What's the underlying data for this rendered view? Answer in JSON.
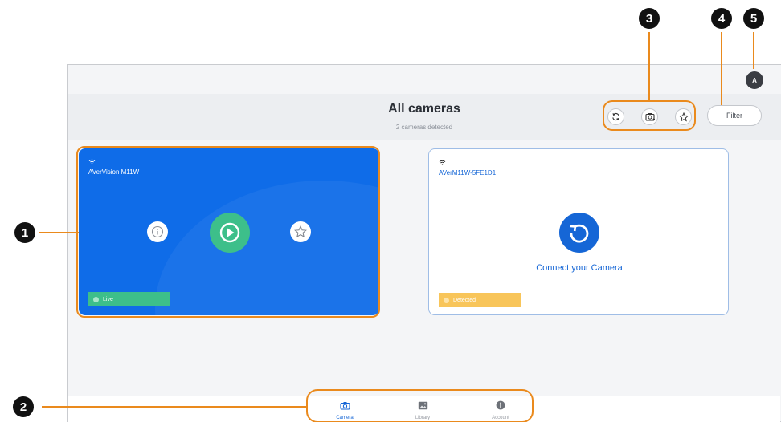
{
  "header": {
    "title": "All cameras",
    "subtitle": "2 cameras detected",
    "filter_label": "Filter",
    "avatar_initial": "A"
  },
  "toolbar_icons": [
    "refresh-icon",
    "camera-add-icon",
    "star-icon"
  ],
  "cameras": [
    {
      "name": "AVerVision M11W",
      "status": "Live",
      "status_color": "#3dbf8a",
      "card_color": "#0f6ce8",
      "actions": [
        "info-icon",
        "play-icon",
        "star-icon"
      ]
    },
    {
      "name": "AVerM11W-5FE1D1",
      "status": "Detected",
      "status_color": "#f8c55a",
      "connect_text": "Connect your Camera"
    }
  ],
  "bottom_nav": [
    {
      "label": "Camera",
      "icon": "camera-icon",
      "active": true
    },
    {
      "label": "Library",
      "icon": "image-icon",
      "active": false
    },
    {
      "label": "Account",
      "icon": "info-icon",
      "active": false
    }
  ],
  "callouts": [
    "1",
    "2",
    "3",
    "4",
    "5"
  ],
  "colors": {
    "accent": "#1566d6",
    "callout": "#ea8a1d",
    "live": "#3dbf8a",
    "detected": "#f8c55a"
  }
}
